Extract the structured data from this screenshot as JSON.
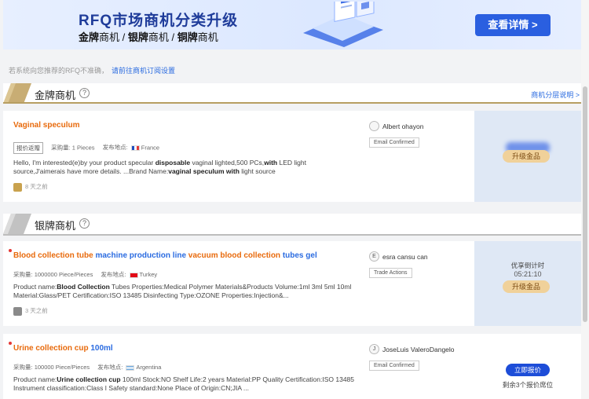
{
  "banner": {
    "title": "RFQ市场商机分类升级",
    "subtitle_parts": [
      "金牌",
      "商机 / ",
      "银牌",
      "商机 / ",
      "铜牌",
      "商机"
    ],
    "cta": "查看详情 >"
  },
  "hint": {
    "text": "若系统向您推荐的RFQ不准确，",
    "link": "请前往商机订阅设置"
  },
  "gold_section": {
    "title": "金牌商机",
    "help_icon": "?",
    "link": "商机分层说明 >"
  },
  "silver_section": {
    "title": "银牌商机",
    "help_icon": "?"
  },
  "cards": [
    {
      "title_parts": [
        {
          "text": "Vaginal speculum",
          "color": "orange"
        }
      ],
      "tag": "报价返赠",
      "qty_label": "采购量:",
      "qty": "1 Pieces",
      "dest_label": "发布地点:",
      "country": "France",
      "desc_html_parts": [
        {
          "t": "Hello, I'm interested(e)by your product specular ",
          "b": false
        },
        {
          "t": "disposable",
          "b": true
        },
        {
          "t": " vaginal lighted,500 PCs,",
          "b": false
        },
        {
          "t": "with",
          "b": true
        },
        {
          "t": " LED light source,J'aimerais have more details. ...Brand Name:",
          "b": false
        },
        {
          "t": "vaginal speculum with",
          "b": true
        },
        {
          "t": " light source",
          "b": false
        }
      ],
      "time": "8 天之前",
      "buyer_initial": "",
      "buyer": "Albert ohayon",
      "buyer_tag": "Email Confirmed",
      "side_action": "升级金品"
    },
    {
      "title_parts": [
        {
          "text": "Blood collection tube",
          "color": "orange"
        },
        {
          "text": " machine production line ",
          "color": "blue"
        },
        {
          "text": "vacuum blood collection",
          "color": "orange"
        },
        {
          "text": " tubes gel",
          "color": "blue"
        }
      ],
      "qty_label": "采购量:",
      "qty": "1000000 Piece/Pieces",
      "dest_label": "发布地点:",
      "country": "Turkey",
      "desc_html_parts": [
        {
          "t": "Product name:",
          "b": false
        },
        {
          "t": "Blood Collection",
          "b": true
        },
        {
          "t": " Tubes Properties:Medical Polymer Materials&Products Volume:1ml 3ml 5ml 10ml Material:Glass/PET Certification:ISO 13485 Disinfecting Type:OZONE Properties:Injection&...",
          "b": false
        }
      ],
      "time": "3 天之前",
      "buyer_initial": "E",
      "buyer": "esra cansu can",
      "buyer_tag": "Trade Actions",
      "countdown_label": "优享倒计时",
      "countdown": "05:21:10",
      "side_action": "升级金品"
    },
    {
      "title_parts": [
        {
          "text": "Urine collection cup",
          "color": "orange"
        },
        {
          "text": " 100ml",
          "color": "blue"
        }
      ],
      "qty_label": "采购量:",
      "qty": "100000 Piece/Pieces",
      "dest_label": "发布地点:",
      "country": "Argentina",
      "desc_html_parts": [
        {
          "t": "Product name:",
          "b": false
        },
        {
          "t": "Urine collection cup",
          "b": true
        },
        {
          "t": " 100ml Stock:NO Shelf Life:2 years Material:PP Quality Certification:ISO 13485 Instrument classification:Class I Safety standard:None Place of Origin:CN;JIA ...",
          "b": false
        }
      ],
      "buyer_initial": "J",
      "buyer": "JoseLuis ValeroDangelo",
      "buyer_tag": "Email Confirmed",
      "quote_button": "立即报价",
      "remain": "剩余3个报价席位"
    }
  ]
}
